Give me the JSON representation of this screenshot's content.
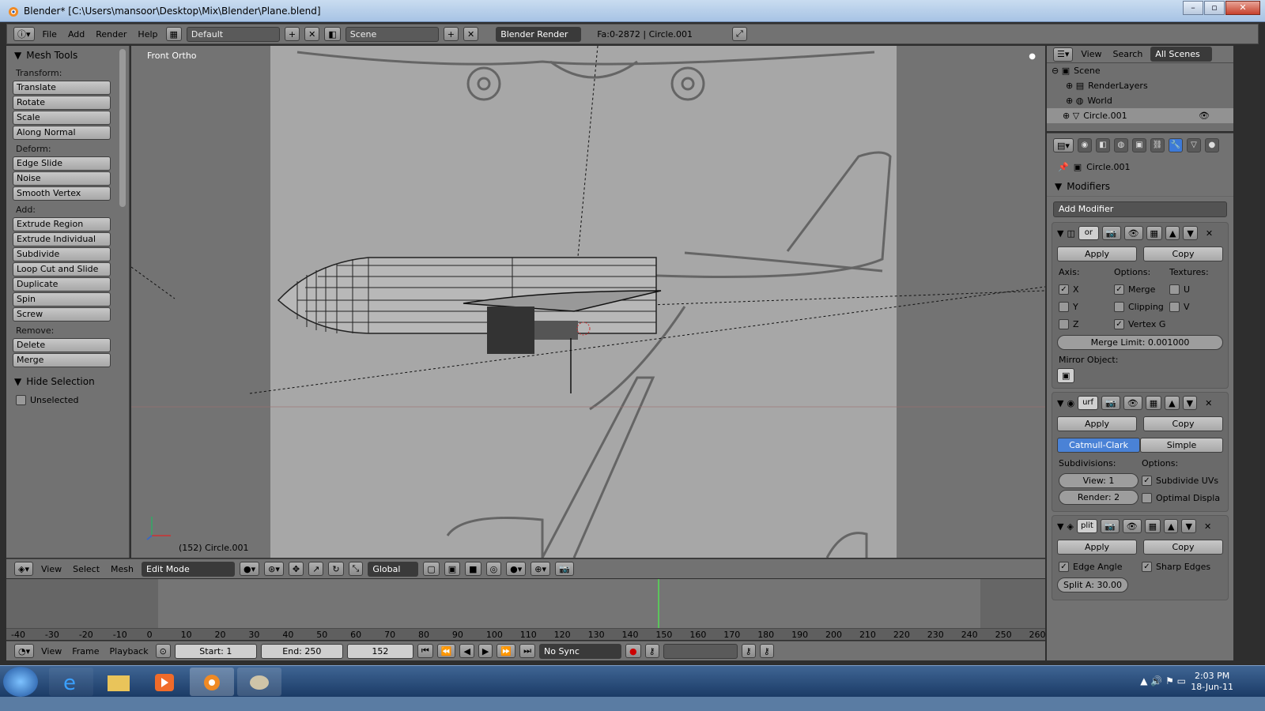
{
  "window": {
    "title": "Blender* [C:\\Users\\mansoor\\Desktop\\Mix\\Blender\\Plane.blend]"
  },
  "topbar": {
    "menus": [
      "File",
      "Add",
      "Render",
      "Help"
    ],
    "layout": "Default",
    "scene": "Scene",
    "engine": "Blender Render",
    "stats": "Fa:0-2872 | Circle.001"
  },
  "toolshelf": {
    "title": "Mesh Tools",
    "groups": {
      "transform": "Transform:",
      "deform": "Deform:",
      "add": "Add:",
      "remove": "Remove:"
    },
    "transform": [
      "Translate",
      "Rotate",
      "Scale",
      "Along Normal"
    ],
    "deform": [
      "Edge Slide",
      "Noise",
      "Smooth Vertex"
    ],
    "add": [
      "Extrude Region",
      "Extrude Individual",
      "Subdivide",
      "Loop Cut and Slide",
      "Duplicate",
      "Spin",
      "Screw"
    ],
    "remove": [
      "Delete",
      "Merge"
    ],
    "hide_title": "Hide Selection",
    "unselected": "Unselected"
  },
  "viewport": {
    "label": "Front Ortho",
    "object": "(152) Circle.001"
  },
  "viewbar": {
    "menus": [
      "View",
      "Select",
      "Mesh"
    ],
    "mode": "Edit Mode",
    "orientation": "Global"
  },
  "timeline": {
    "ticks": [
      "-40",
      "-30",
      "-20",
      "-10",
      "0",
      "10",
      "20",
      "30",
      "40",
      "50",
      "60",
      "70",
      "80",
      "90",
      "100",
      "110",
      "120",
      "130",
      "140",
      "150",
      "160",
      "170",
      "180",
      "190",
      "200",
      "210",
      "220",
      "230",
      "240",
      "250",
      "260"
    ],
    "current_frame_pct": 0.627
  },
  "timebar": {
    "menus": [
      "View",
      "Frame",
      "Playback"
    ],
    "start": "Start: 1",
    "end": "End: 250",
    "frame": "152",
    "sync": "No Sync"
  },
  "outliner": {
    "menus": [
      "View",
      "Search"
    ],
    "filter": "All Scenes",
    "items": [
      "Scene",
      "RenderLayers",
      "World",
      "Circle.001"
    ]
  },
  "properties": {
    "object": "Circle.001",
    "section": "Modifiers",
    "add_modifier": "Add Modifier",
    "apply": "Apply",
    "copy": "Copy",
    "mirror": {
      "name": "or",
      "axis_label": "Axis:",
      "options_label": "Options:",
      "textures_label": "Textures:",
      "x": "X",
      "y": "Y",
      "z": "Z",
      "merge": "Merge",
      "clipping": "Clipping",
      "vertex_g": "Vertex G",
      "u": "U",
      "v": "V",
      "merge_limit": "Merge Limit: 0.001000",
      "mirror_object": "Mirror Object:"
    },
    "subsurf": {
      "name": "urf",
      "catmull": "Catmull-Clark",
      "simple": "Simple",
      "subdivisions": "Subdivisions:",
      "options": "Options:",
      "view": "View: 1",
      "render": "Render: 2",
      "subdivide_uvs": "Subdivide UVs",
      "optimal": "Optimal Displa"
    },
    "split": {
      "name": "plit",
      "edge_angle": "Edge Angle",
      "sharp_edges": "Sharp Edges",
      "split_angle": "Split A: 30.00"
    }
  },
  "taskbar": {
    "time": "2:03 PM",
    "date": "18-Jun-11"
  }
}
